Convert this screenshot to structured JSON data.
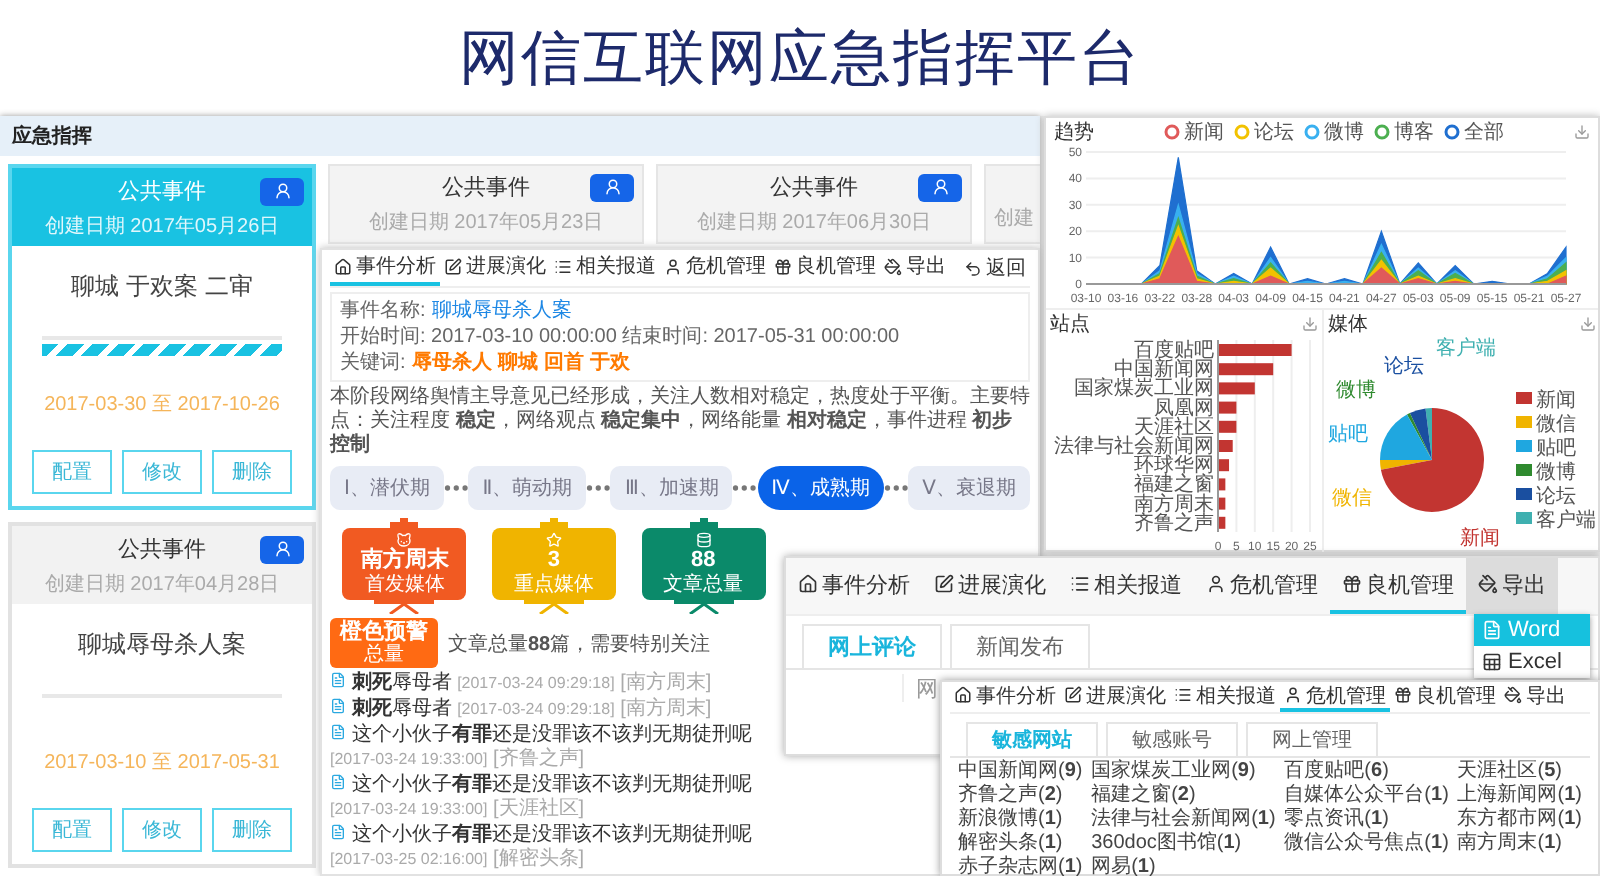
{
  "page_title": "网信互联网应急指挥平台",
  "dashboard": {
    "title": "应急指挥",
    "event_cards": [
      {
        "title": "公共事件",
        "created": "创建日期 2017年05月26日",
        "name": "聊城 于欢案 二审",
        "level": 1,
        "period": "2017-03-30 至 2017-10-26",
        "buttons": [
          "配置",
          "修改",
          "删除"
        ],
        "selected": true
      },
      {
        "title": "公共事件",
        "created": "创建日期 2017年04月28日",
        "name": "聊城辱母杀人案",
        "level": 0,
        "period": "2017-03-10 至 2017-05-31",
        "buttons": [
          "配置",
          "修改",
          "删除"
        ],
        "selected": false
      }
    ],
    "background_cards": [
      {
        "title": "公共事件",
        "created": "创建日期 2017年05月23日"
      },
      {
        "title": "公共事件",
        "created": "创建日期 2017年06月30日"
      },
      {
        "created": "创建"
      }
    ]
  },
  "event_panel": {
    "tabs": [
      {
        "label": "事件分析",
        "selected": true
      },
      {
        "label": "进展演化",
        "selected": false
      },
      {
        "label": "相关报道",
        "selected": false
      },
      {
        "label": "危机管理",
        "selected": false
      },
      {
        "label": "良机管理",
        "selected": false
      },
      {
        "label": "导出",
        "selected": false
      }
    ],
    "back": "返回",
    "info": {
      "name_label": "事件名称:",
      "name": "聊城辱母杀人案",
      "time": "开始时间: 2017-03-10 00:00:00 结束时间: 2017-05-31 00:00:00",
      "keywords_label": "关键词:",
      "keywords": [
        "辱母杀人",
        "聊城",
        "回首",
        "于欢"
      ]
    },
    "summary": "本阶段网络舆情主导意见已经形成，关注人数相对稳定，热度处于平衡。主要特点：关注程度 **稳定**，网络观点 **稳定集中**，网络能量 **相对稳定**，事件进程 **初步控制**",
    "stages": [
      {
        "label": "Ⅰ、潜伏期",
        "selected": false
      },
      {
        "label": "Ⅱ、萌动期",
        "selected": false
      },
      {
        "label": "Ⅲ、加速期",
        "selected": false
      },
      {
        "label": "Ⅳ、成熟期",
        "selected": true
      },
      {
        "label": "Ⅴ、衰退期",
        "selected": false
      }
    ],
    "boards": [
      {
        "value": "南方周末",
        "label": "首发媒体",
        "color": "#f15a22"
      },
      {
        "value": "3",
        "label": "重点媒体",
        "color": "#f0b400"
      },
      {
        "value": "88",
        "label": "文章总量",
        "color": "#0b8a6a"
      }
    ],
    "alert": {
      "title": "橙色预警",
      "subtitle": "总量",
      "text": "文章总量**88**篇，需要特别关注"
    },
    "news": [
      {
        "title": "**刺死**辱母者",
        "date": "[2017-03-24 09:29:18]",
        "source": "[南方周末]"
      },
      {
        "title": "**刺死**辱母者",
        "date": "[2017-03-24 09:29:18]",
        "source": "[南方周末]"
      },
      {
        "title": "这个小伙子**有罪**还是没罪该不该判无期徒刑呢",
        "date": "[2017-03-24 19:33:00]",
        "source": "[齐鲁之声]"
      },
      {
        "title": "这个小伙子**有罪**还是没罪该不该判无期徒刑呢",
        "date": "[2017-03-24 19:33:00]",
        "source": "[天涯社区]"
      },
      {
        "title": "这个小伙子**有罪**还是没罪该不该判无期徒刑呢",
        "date": "[2017-03-25 02:16:00]",
        "source": "[解密头条]"
      }
    ]
  },
  "charts_panel": {
    "trend": {
      "chart_data": {
        "type": "area",
        "title": "趋势",
        "categories": [
          "03-10",
          null,
          "03-16",
          null,
          "03-22",
          null,
          "03-28",
          null,
          "04-03",
          null,
          "04-09",
          null,
          "04-15",
          null,
          "04-21",
          null,
          "04-27",
          null,
          "05-03",
          null,
          "05-09",
          null,
          "05-15",
          null,
          "05-21",
          null,
          "05-27"
        ],
        "series": [
          {
            "name": "新闻",
            "color": "#e05a5a",
            "values": [
              0,
              0,
              0,
              0,
              2,
              18,
              1,
              0,
              0,
              0,
              3,
              0,
              0,
              0,
              0,
              0,
              6,
              0,
              2,
              0,
              1,
              0,
              0,
              0,
              0,
              0,
              3
            ]
          },
          {
            "name": "论坛",
            "color": "#f2c200",
            "values": [
              0,
              0,
              0,
              0,
              3,
              22,
              2,
              0,
              1,
              0,
              6,
              0,
              0,
              0,
              0,
              0,
              9,
              0,
              3,
              0,
              2,
              0,
              0,
              0,
              0,
              1,
              5
            ]
          },
          {
            "name": "微博",
            "color": "#39b0f0",
            "values": [
              0,
              0,
              0,
              0,
              5,
              30,
              4,
              0,
              3,
              0,
              10,
              0,
              1,
              0,
              1,
              0,
              15,
              0,
              6,
              0,
              5,
              0,
              0,
              0,
              0,
              3,
              10
            ]
          },
          {
            "name": "博客",
            "color": "#4caf50",
            "values": [
              0,
              0,
              0,
              0,
              4,
              25,
              3,
              0,
              2,
              0,
              8,
              0,
              0,
              0,
              0,
              0,
              12,
              0,
              5,
              0,
              4,
              0,
              0,
              0,
              0,
              2,
              8
            ]
          },
          {
            "name": "全部",
            "color": "#1f6fd0",
            "values": [
              0,
              0,
              0,
              0,
              7,
              48,
              5,
              0,
              4,
              0,
              14,
              0,
              2,
              0,
              2,
              0,
              20,
              0,
              8,
              0,
              7,
              0,
              1,
              0,
              0,
              4,
              14
            ]
          }
        ],
        "ylim": [
          0,
          50
        ],
        "grid": true,
        "yticks": [
          0,
          10,
          20,
          30,
          40,
          50
        ]
      }
    },
    "sites": {
      "chart_data": {
        "type": "bar",
        "title": "站点",
        "orientation": "horizontal",
        "categories": [
          "百度贴吧",
          "中国新闻网",
          "国家煤炭工业网",
          "凤凰网",
          "天涯社区",
          "法律与社会新闻网",
          "环球华网",
          "福建之窗",
          "南方周末",
          "齐鲁之声"
        ],
        "values": [
          20,
          15,
          10,
          5,
          5,
          4,
          3,
          2,
          2,
          2
        ],
        "xlim": [
          0,
          25
        ],
        "grid": true,
        "xticks": [
          0,
          5,
          10,
          15,
          20,
          25
        ]
      }
    },
    "media": {
      "title": "媒体",
      "slices": [
        {
          "label": "客户端",
          "color": "#3fb0b0"
        },
        {
          "label": "论坛",
          "color": "#1a4fa0"
        },
        {
          "label": "微博",
          "color": "#2f8a2f"
        },
        {
          "label": "贴吧",
          "color": "#1fa7e0"
        },
        {
          "label": "微信",
          "color": "#f0b400"
        },
        {
          "label": "新闻",
          "color": "#c23531"
        }
      ],
      "legend": [
        {
          "label": "新闻",
          "color": "#c23531"
        },
        {
          "label": "微信",
          "color": "#f0b400"
        },
        {
          "label": "贴吧",
          "color": "#1fa7e0"
        },
        {
          "label": "微博",
          "color": "#2f8a2f"
        },
        {
          "label": "论坛",
          "color": "#1a4fa0"
        },
        {
          "label": "客户端",
          "color": "#3fb0b0"
        }
      ]
    }
  },
  "zoom_panel": {
    "tabs": [
      {
        "label": "事件分析",
        "selected": false,
        "open": false
      },
      {
        "label": "进展演化",
        "selected": false,
        "open": false
      },
      {
        "label": "相关报道",
        "selected": false,
        "open": false
      },
      {
        "label": "危机管理",
        "selected": false,
        "open": false
      },
      {
        "label": "良机管理",
        "selected": true,
        "open": false
      },
      {
        "label": "导出",
        "selected": false,
        "open": true
      }
    ],
    "menu": [
      {
        "label": "Word",
        "selected": true
      },
      {
        "label": "Excel",
        "selected": false
      }
    ],
    "subtabs": [
      {
        "label": "网上评论",
        "selected": true
      },
      {
        "label": "新闻发布",
        "selected": false
      }
    ],
    "column_fragment": "网"
  },
  "sites_panel": {
    "tabs": [
      {
        "label": "事件分析",
        "selected": false
      },
      {
        "label": "进展演化",
        "selected": false
      },
      {
        "label": "相关报道",
        "selected": false
      },
      {
        "label": "危机管理",
        "selected": true
      },
      {
        "label": "良机管理",
        "selected": false
      },
      {
        "label": "导出",
        "selected": false
      }
    ],
    "subtabs": [
      {
        "label": "敏感网站",
        "selected": true
      },
      {
        "label": "敏感账号",
        "selected": false
      },
      {
        "label": "网上管理",
        "selected": false
      }
    ],
    "sites": [
      "中国新闻网(**9**)",
      "国家煤炭工业网(**9**)",
      "百度贴吧(**6**)",
      "天涯社区(**5**)",
      "齐鲁之声(**2**)",
      "福建之窗(**2**)",
      "自媒体公众平台(**1**)",
      "上海新闻网(**1**)",
      "新浪微博(**1**)",
      "法律与社会新闻网(**1**)",
      "零点资讯(**1**)",
      "东方都市网(**1**)",
      "解密头条(**1**)",
      "360doc图书馆(**1**)",
      "微信公众号焦点(**1**)",
      "南方周末(**1**)",
      "赤子杂志网(**1**)",
      "网易(**1**)"
    ]
  }
}
